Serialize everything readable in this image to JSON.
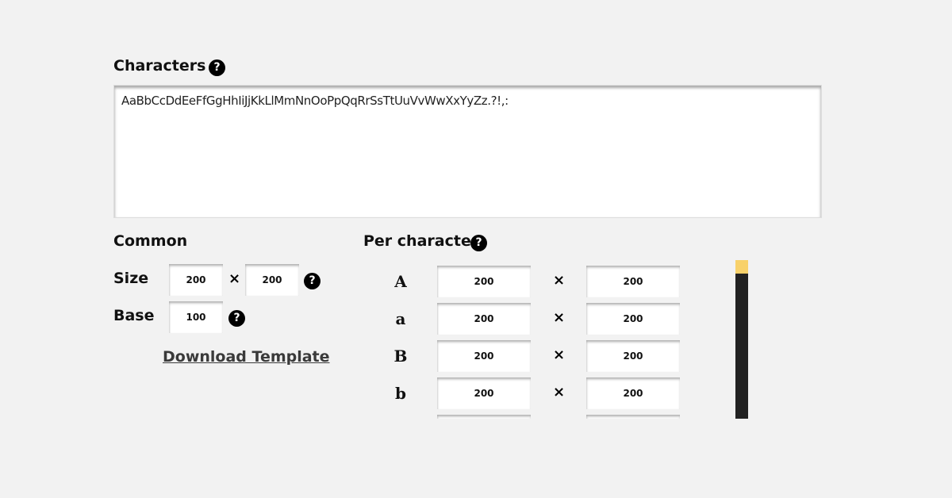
{
  "characters": {
    "heading": "Characters",
    "help_icon": "?",
    "value": "AaBbCcDdEeFfGgHhIiJjKkLlMmNnOoPpQqRrSsTtUuVvWwXxYyZz.?!,:"
  },
  "common": {
    "heading": "Common",
    "size_label": "Size",
    "size_width": "200",
    "size_height": "200",
    "times_symbol": "×",
    "base_label": "Base",
    "base_value": "100",
    "help_icon": "?",
    "download_label": "Download Template"
  },
  "per_character": {
    "heading": "Per character",
    "help_icon": "?",
    "rows": [
      {
        "glyph": "A",
        "width": "200",
        "height": "200"
      },
      {
        "glyph": "a",
        "width": "200",
        "height": "200"
      },
      {
        "glyph": "B",
        "width": "200",
        "height": "200"
      },
      {
        "glyph": "b",
        "width": "200",
        "height": "200"
      }
    ],
    "times_symbol": "×"
  },
  "colors": {
    "background": "#f2f2f2",
    "scrollbar_track": "#222222",
    "scrollbar_thumb": "#f8d16a"
  }
}
